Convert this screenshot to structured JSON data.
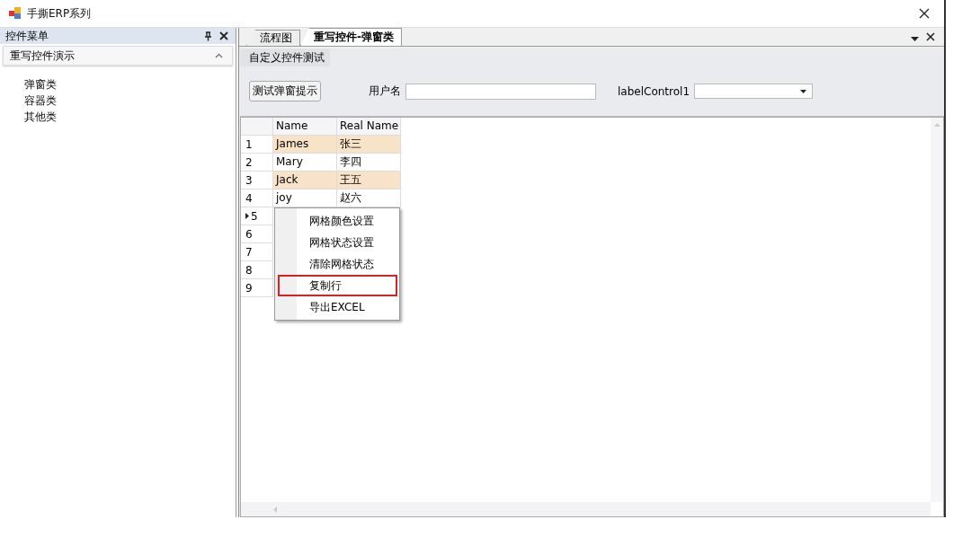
{
  "window": {
    "title": "手撕ERP系列"
  },
  "sidebar": {
    "title": "控件菜单",
    "group": {
      "label": "重写控件演示",
      "expanded": true
    },
    "items": [
      {
        "label": "弹窗类"
      },
      {
        "label": "容器类"
      },
      {
        "label": "其他类"
      }
    ]
  },
  "tabs": [
    {
      "label": "流程图",
      "selected": false
    },
    {
      "label": "重写控件-弹窗类",
      "selected": true
    }
  ],
  "panel": {
    "title": "自定义控件测试",
    "button": "测试弹窗提示",
    "username_label": "用户名",
    "combo_label": "labelControl1"
  },
  "table": {
    "columns": [
      "Name",
      "Real Name"
    ],
    "rows": [
      {
        "number": "1",
        "current": false,
        "highlighted": true,
        "cells": [
          "James",
          "张三"
        ]
      },
      {
        "number": "2",
        "current": false,
        "highlighted": false,
        "cells": [
          "Mary",
          "李四"
        ]
      },
      {
        "number": "3",
        "current": false,
        "highlighted": true,
        "cells": [
          "Jack",
          "王五"
        ]
      },
      {
        "number": "4",
        "current": false,
        "highlighted": false,
        "cells": [
          "joy",
          "赵六"
        ]
      },
      {
        "number": "5",
        "current": true
      },
      {
        "number": "6",
        "current": false
      },
      {
        "number": "7",
        "current": false
      },
      {
        "number": "8",
        "current": false
      },
      {
        "number": "9",
        "current": false
      }
    ]
  },
  "context_menu": [
    {
      "label": "网格颜色设置",
      "marked": false
    },
    {
      "label": "网格状态设置",
      "marked": false
    },
    {
      "label": "清除网格状态",
      "marked": false
    },
    {
      "label": "复制行",
      "marked": true
    },
    {
      "label": "导出EXCEL",
      "marked": false
    }
  ]
}
